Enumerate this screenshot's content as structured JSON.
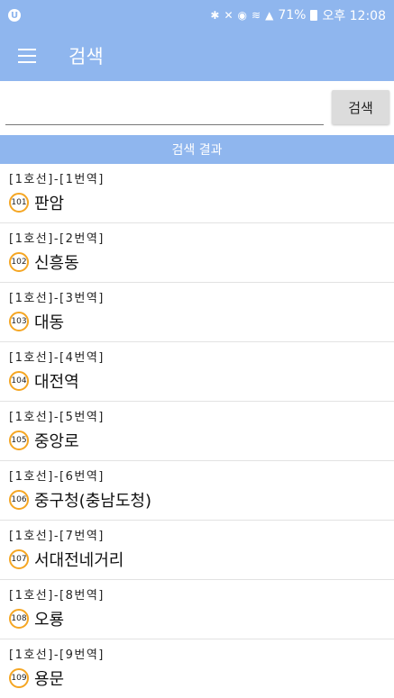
{
  "status_bar": {
    "battery": "71%",
    "time": "오후 12:08",
    "icons": [
      "app-icon",
      "bluetooth-icon",
      "mute-icon",
      "alarm-icon",
      "wifi-icon",
      "signal-icon",
      "battery-icon"
    ]
  },
  "app_bar": {
    "title": "검색",
    "menu_icon": "hamburger-menu-icon"
  },
  "search": {
    "value": "",
    "placeholder": "",
    "button_label": "검색"
  },
  "results": {
    "header": "검색 결과",
    "items": [
      {
        "line": "[1호선]-[1번역]",
        "number": "101",
        "name": "판암"
      },
      {
        "line": "[1호선]-[2번역]",
        "number": "102",
        "name": "신흥동"
      },
      {
        "line": "[1호선]-[3번역]",
        "number": "103",
        "name": "대동"
      },
      {
        "line": "[1호선]-[4번역]",
        "number": "104",
        "name": "대전역"
      },
      {
        "line": "[1호선]-[5번역]",
        "number": "105",
        "name": "중앙로"
      },
      {
        "line": "[1호선]-[6번역]",
        "number": "106",
        "name": "중구청(충남도청)"
      },
      {
        "line": "[1호선]-[7번역]",
        "number": "107",
        "name": "서대전네거리"
      },
      {
        "line": "[1호선]-[8번역]",
        "number": "108",
        "name": "오룡"
      },
      {
        "line": "[1호선]-[9번역]",
        "number": "109",
        "name": "용문"
      }
    ]
  },
  "colors": {
    "accent": "#8fb6ee",
    "badge_border": "#f5a623",
    "button_bg": "#dcdcdc"
  }
}
